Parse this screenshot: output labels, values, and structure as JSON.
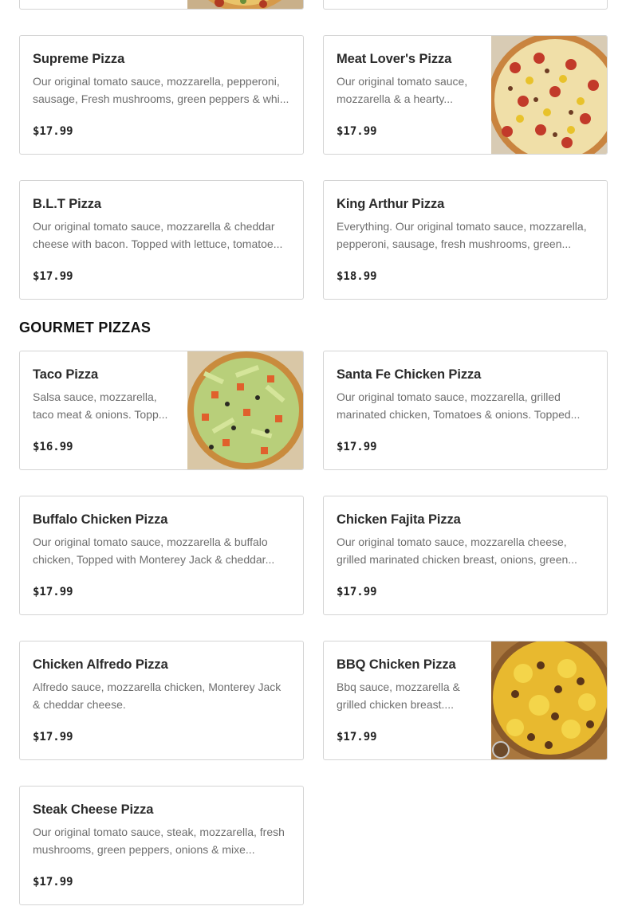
{
  "top_partial": {
    "left": {
      "image_icon": "pizza-photo"
    },
    "right": {}
  },
  "sections": [
    {
      "items": [
        {
          "name": "Supreme Pizza",
          "description": "Our original tomato sauce, mozzarella, pepperoni, sausage, Fresh mushrooms, green peppers & whi...",
          "price": "$17.99"
        },
        {
          "name": "Meat Lover's Pizza",
          "description": "Our original tomato sauce, mozzarella & a hearty...",
          "price": "$17.99",
          "image_icon": "pizza-photo"
        },
        {
          "name": "B.L.T Pizza",
          "description": "Our original tomato sauce, mozzarella & cheddar cheese with bacon. Topped with lettuce, tomatoe...",
          "price": "$17.99"
        },
        {
          "name": "King Arthur Pizza",
          "description": "Everything. Our original tomato sauce, mozzarella, pepperoni, sausage, fresh mushrooms, green...",
          "price": "$18.99"
        }
      ]
    },
    {
      "heading": "GOURMET PIZZAS",
      "items": [
        {
          "name": "Taco Pizza",
          "description": "Salsa sauce, mozzarella, taco meat & onions. Topp...",
          "price": "$16.99",
          "image_icon": "pizza-photo"
        },
        {
          "name": "Santa Fe Chicken Pizza",
          "description": "Our original tomato sauce, mozzarella, grilled marinated chicken, Tomatoes & onions. Topped...",
          "price": "$17.99"
        },
        {
          "name": "Buffalo Chicken Pizza",
          "description": "Our original tomato sauce, mozzarella & buffalo chicken, Topped with Monterey Jack & cheddar...",
          "price": "$17.99"
        },
        {
          "name": "Chicken Fajita Pizza",
          "description": "Our original tomato sauce, mozzarella cheese, grilled marinated chicken breast, onions, green...",
          "price": "$17.99"
        },
        {
          "name": "Chicken Alfredo Pizza",
          "description": "Alfredo sauce, mozzarella chicken, Monterey Jack & cheddar cheese.",
          "price": "$17.99"
        },
        {
          "name": "BBQ Chicken Pizza",
          "description": "Bbq sauce, mozzarella & grilled chicken breast....",
          "price": "$17.99",
          "image_icon": "pizza-photo"
        },
        {
          "name": "Steak Cheese Pizza",
          "description": "Our original tomato sauce, steak, mozzarella, fresh mushrooms, green peppers, onions & mixe...",
          "price": "$17.99"
        }
      ]
    }
  ],
  "colors": {
    "border": "#d4d4d4",
    "text": "#2b2b2b",
    "muted": "#6e6e6e",
    "background": "#ffffff"
  }
}
